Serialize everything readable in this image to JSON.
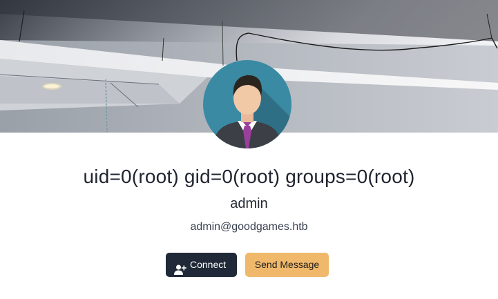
{
  "profile": {
    "title": "uid=0(root) gid=0(root) groups=0(root)",
    "username": "admin",
    "email": "admin@goodgames.htb"
  },
  "actions": {
    "connect_label": "Connect",
    "connect_icon": "user-plus-icon",
    "message_label": "Send Message"
  },
  "colors": {
    "connect_bg": "#1f2937",
    "message_bg": "#f0b86a",
    "text": "#1f2430"
  }
}
